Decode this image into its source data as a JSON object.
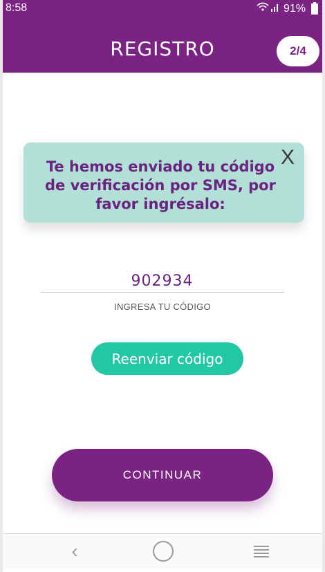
{
  "status_bar": {
    "time": "8:58",
    "battery": "91%",
    "signal": "wifi-signal-icon"
  },
  "header": {
    "title": "REGISTRO",
    "step": "2/4"
  },
  "notice": {
    "message": "Te hemos enviado tu código de verificación por SMS, por favor ingrésalo:",
    "close_symbol": "X"
  },
  "code_input": {
    "value": "902934",
    "label": "INGRESA TU CÓDIGO"
  },
  "actions": {
    "resend_label": "Reenviar código",
    "continue_label": "CONTINUAR"
  },
  "nav": {
    "back_symbol": "‹"
  },
  "colors": {
    "primary": "#7a2383",
    "accent": "#22c8a3",
    "notice_bg": "#b2e0d6"
  }
}
